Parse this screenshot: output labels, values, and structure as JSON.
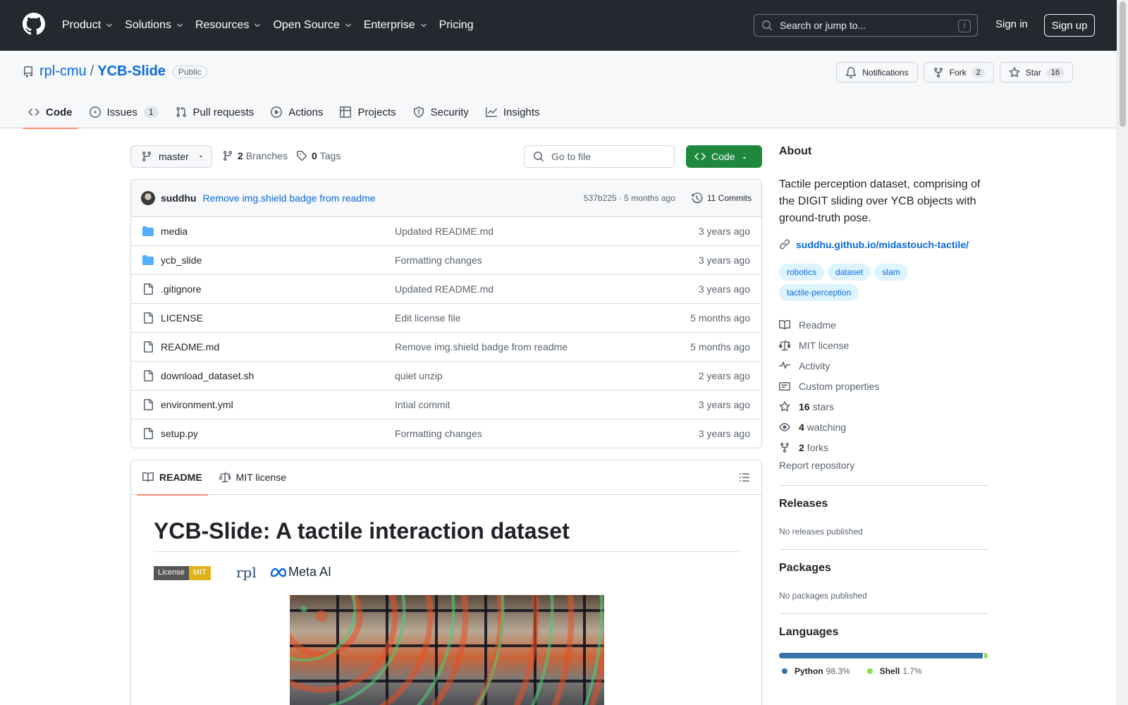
{
  "header": {
    "nav": [
      {
        "label": "Product",
        "dropdown": true
      },
      {
        "label": "Solutions",
        "dropdown": true
      },
      {
        "label": "Resources",
        "dropdown": true
      },
      {
        "label": "Open Source",
        "dropdown": true
      },
      {
        "label": "Enterprise",
        "dropdown": true
      },
      {
        "label": "Pricing",
        "dropdown": false
      }
    ],
    "search_placeholder": "Search or jump to...",
    "search_key": "/",
    "sign_in": "Sign in",
    "sign_up": "Sign up"
  },
  "repo": {
    "owner": "rpl-cmu",
    "separator": "/",
    "name": "YCB-Slide",
    "visibility": "Public",
    "notifications_label": "Notifications",
    "fork_label": "Fork",
    "fork_count": "2",
    "star_label": "Star",
    "star_count": "16"
  },
  "tabs": [
    {
      "label": "Code",
      "icon": "code-icon",
      "active": true,
      "count": ""
    },
    {
      "label": "Issues",
      "icon": "issue-icon",
      "active": false,
      "count": "1"
    },
    {
      "label": "Pull requests",
      "icon": "pull-request-icon",
      "active": false,
      "count": ""
    },
    {
      "label": "Actions",
      "icon": "play-icon",
      "active": false,
      "count": ""
    },
    {
      "label": "Projects",
      "icon": "table-icon",
      "active": false,
      "count": ""
    },
    {
      "label": "Security",
      "icon": "shield-icon",
      "active": false,
      "count": ""
    },
    {
      "label": "Insights",
      "icon": "graph-icon",
      "active": false,
      "count": ""
    }
  ],
  "toolbar": {
    "branch": "master",
    "branches_count": "2",
    "branches_label": "Branches",
    "tags_count": "0",
    "tags_label": "Tags",
    "go_to_file": "Go to file",
    "code_label": "Code"
  },
  "commit": {
    "author": "suddhu",
    "message": "Remove img.shield badge from readme",
    "meta": "537b225 · 5 months ago",
    "commits_label": "11 Commits"
  },
  "files": [
    {
      "name": "media",
      "type": "dir",
      "message": "Updated README.md",
      "age": "3 years ago"
    },
    {
      "name": "ycb_slide",
      "type": "dir",
      "message": "Formatting changes",
      "age": "3 years ago"
    },
    {
      "name": ".gitignore",
      "type": "file",
      "message": "Updated README.md",
      "age": "3 years ago"
    },
    {
      "name": "LICENSE",
      "type": "file",
      "message": "Edit license file",
      "age": "5 months ago"
    },
    {
      "name": "README.md",
      "type": "file",
      "message": "Remove img.shield badge from readme",
      "age": "5 months ago"
    },
    {
      "name": "download_dataset.sh",
      "type": "file",
      "message": "quiet unzip",
      "age": "2 years ago"
    },
    {
      "name": "environment.yml",
      "type": "file",
      "message": "Intial commit",
      "age": "3 years ago"
    },
    {
      "name": "setup.py",
      "type": "file",
      "message": "Formatting changes",
      "age": "3 years ago"
    }
  ],
  "readme": {
    "tab_readme": "README",
    "tab_license": "MIT license",
    "title": "YCB-Slide: A tactile interaction dataset",
    "badge_left": "License",
    "badge_right": "MIT",
    "logo_rpl": "rpl",
    "logo_meta": "Meta AI"
  },
  "about": {
    "heading": "About",
    "description": "Tactile perception dataset, comprising of the DIGIT sliding over YCB objects with ground-truth pose.",
    "link": "suddhu.github.io/midastouch-tactile/",
    "topics": [
      "robotics",
      "dataset",
      "slam",
      "tactile-perception"
    ],
    "items": [
      {
        "icon": "book-icon",
        "count": "",
        "label": "Readme"
      },
      {
        "icon": "law-icon",
        "count": "",
        "label": "MIT license"
      },
      {
        "icon": "pulse-icon",
        "count": "",
        "label": "Activity"
      },
      {
        "icon": "note-icon",
        "count": "",
        "label": "Custom properties"
      },
      {
        "icon": "star-icon",
        "count": "16",
        "label": "stars"
      },
      {
        "icon": "eye-icon",
        "count": "4",
        "label": "watching"
      },
      {
        "icon": "fork-icon",
        "count": "2",
        "label": "forks"
      }
    ],
    "report": "Report repository"
  },
  "releases": {
    "heading": "Releases",
    "text": "No releases published"
  },
  "packages": {
    "heading": "Packages",
    "text": "No packages published"
  },
  "languages": {
    "heading": "Languages",
    "items": [
      {
        "name": "Python",
        "percent": "98.3%",
        "value": 98.3,
        "color": "#3572A5"
      },
      {
        "name": "Shell",
        "percent": "1.7%",
        "value": 1.7,
        "color": "#89e051"
      }
    ]
  }
}
